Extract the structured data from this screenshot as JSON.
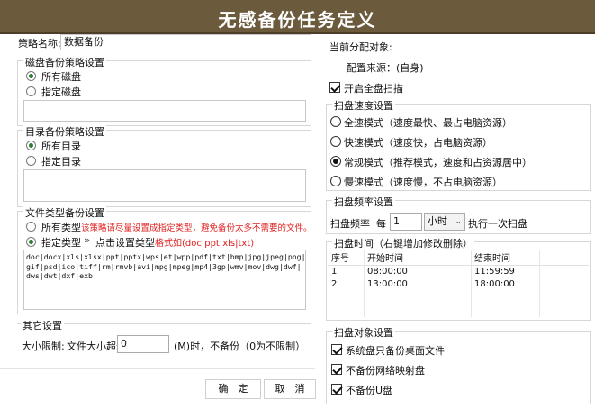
{
  "window": {
    "title": "无感备份任务定义"
  },
  "left": {
    "policy_name_label": "策略名称:",
    "policy_name_value": "数据备份",
    "disk_group": {
      "title": "磁盘备份策略设置",
      "options": [
        "所有磁盘",
        "指定磁盘"
      ]
    },
    "dir_group": {
      "title": "目录备份策略设置",
      "options": [
        "所有目录",
        "指定目录"
      ]
    },
    "filetype_group": {
      "title": "文件类型备份设置",
      "all_types_label": "所有类型",
      "warning": "该策略请尽量设置成指定类型，避免备份太多不需要的文件。",
      "specified_label": "指定类型",
      "set_types_link": "点击设置类型",
      "format_hint": "格式如(doc|ppt|xls|txt)",
      "types_lines": [
        "doc|docx|xls|xlsx|ppt|pptx|wps|et|wpp|pdf|txt|bmp|jpg|jpeg|png|",
        "gif|psd|ico|tiff|rm|rmvb|avi|mpg|mpeg|mp4|3gp|wmv|mov|dwg|dwf|",
        "dws|dwt|dxf|exb"
      ]
    },
    "other_group": {
      "title": "其它设置",
      "size_limit_label": "大小限制:",
      "size_prefix": "文件大小超过",
      "size_value": "0",
      "size_suffix": "(M)时，不备份（0为不限制）"
    },
    "ok_button": "确　定",
    "cancel_button": "取　消"
  },
  "right": {
    "assigned_label": "当前分配对象:",
    "config_source": "配置来源：(自身)",
    "full_scan_label": "开启全盘扫描",
    "speed_group": {
      "title": "扫盘速度设置",
      "options": [
        "全速模式（速度最快、最占电脑资源）",
        "快速模式（速度快，占电脑资源）",
        "常规模式（推荐模式，速度和占资源居中）",
        "慢速模式（速度慢，不占电脑资源）"
      ],
      "selected_index": 2
    },
    "freq_group": {
      "title": "扫盘频率设置",
      "freq_label": "扫盘频率",
      "every_label": "每",
      "every_value": "1",
      "unit_value": "小时",
      "after_label": "执行一次扫盘"
    },
    "schedule_group": {
      "title": "扫盘时间（右键增加修改删除）",
      "headers": [
        "序号",
        "开始时间",
        "结束时间"
      ],
      "rows": [
        [
          "1",
          "08:00:00",
          "11:59:59"
        ],
        [
          "2",
          "13:00:00",
          "18:00:00"
        ]
      ]
    },
    "target_group": {
      "title": "扫盘对象设置",
      "options": [
        "系统盘只备份桌面文件",
        "不备份网络映射盘",
        "不备份U盘"
      ]
    }
  }
}
